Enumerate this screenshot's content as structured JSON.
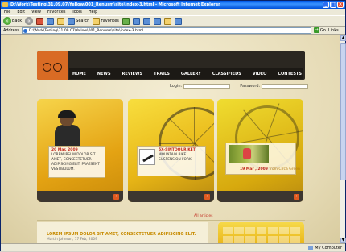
{
  "window": {
    "title": "D:\\Work\\Testing\\31.09.07\\Yellow\\001_Renusm\\site\\index-3.html - Microsoft Internet Explorer",
    "buttons": [
      "_",
      "□",
      "×"
    ]
  },
  "menu": [
    "File",
    "Edit",
    "View",
    "Favorites",
    "Tools",
    "Help"
  ],
  "toolbar": {
    "back": "Back",
    "search": "Search",
    "favorites": "Favorites"
  },
  "address": {
    "label": "Address",
    "value": "D:\\Work\\Testing\\31.09.07\\Yellow\\001_Renusm\\site\\index-3.html",
    "go": "Go",
    "links": "Links"
  },
  "nav": [
    "HOME",
    "NEWS",
    "REVIEWS",
    "TRAILS",
    "GALLERY",
    "CLASSIFIEDS",
    "VIDEO",
    "CONTESTS"
  ],
  "login": {
    "login_label": "Login:",
    "password_label": "Password:"
  },
  "panels": [
    {
      "date": "20 Mar, 2009",
      "text": "LOREM IPSUM DOLOR SIT AMET, CONSECTETUER ADIPISCING ELIT. PRAESENT VESTIBULUM."
    },
    {
      "date": "5X-SINTOOUR KET",
      "text": "MOUNTAIN BIKE SUSPENSION FORK"
    },
    {
      "date": "19 Mar , 2009",
      "date_by": "from Circa Green"
    }
  ],
  "all_articles": "All articles",
  "lower": {
    "title": "LOREM IPSUM DOLOR SIT AMET, CONSECTETUER ADIPISCING ELIT.",
    "meta": "Martin Johnson, 17 Feb, 2009"
  },
  "status": {
    "text": "",
    "zone": "My Computer"
  }
}
